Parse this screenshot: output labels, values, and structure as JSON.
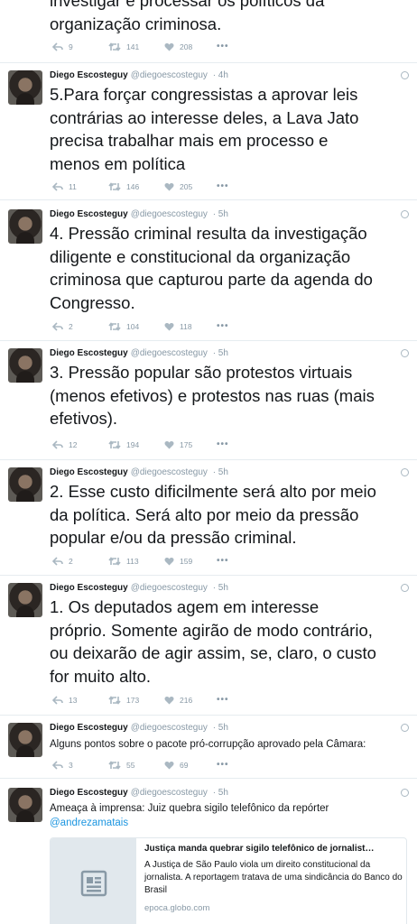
{
  "author": {
    "name": "Diego Escosteguy",
    "handle": "@diegoescosteguy"
  },
  "tweets": [
    {
      "time": "",
      "text": "investigar e processar os políticos da\norganização criminosa.",
      "replies": "9",
      "retweets": "141",
      "likes": "208"
    },
    {
      "time": "· 4h",
      "text": "5.Para forçar congressistas a aprovar leis\ncontrárias ao interesse deles, a Lava Jato\nprecisa trabalhar mais em processo e\nmenos em política",
      "replies": "11",
      "retweets": "146",
      "likes": "205"
    },
    {
      "time": "· 5h",
      "text": "4. Pressão criminal resulta da investigação\ndiligente e constitucional da organização\ncriminosa que capturou parte da agenda do\nCongresso.",
      "replies": "2",
      "retweets": "104",
      "likes": "118"
    },
    {
      "time": "· 5h",
      "text": "3. Pressão popular são protestos virtuais\n(menos efetivos) e protestos nas ruas (mais\nefetivos).",
      "replies": "12",
      "retweets": "194",
      "likes": "175"
    },
    {
      "time": "· 5h",
      "text": "2. Esse custo dificilmente será alto por meio\nda política. Será alto por meio da pressão\npopular e/ou da pressão criminal.",
      "replies": "2",
      "retweets": "113",
      "likes": "159"
    },
    {
      "time": "· 5h",
      "text": "1. Os deputados agem em interesse\npróprio. Somente agirão de modo contrário,\nou deixarão de agir assim, se, claro, o custo\nfor muito alto.",
      "replies": "13",
      "retweets": "173",
      "likes": "216"
    },
    {
      "time": "· 5h",
      "text": "Alguns pontos sobre o pacote pró-corrupção aprovado pela Câmara:",
      "replies": "3",
      "retweets": "55",
      "likes": "69"
    },
    {
      "time": "· 5h",
      "text": "Ameaça à imprensa: Juiz quebra sigilo telefônico da repórter",
      "mention": "@andrezamatais",
      "card": {
        "title": "Justiça manda quebrar sigilo telefônico de jornalist…",
        "description": "A Justiça de São Paulo viola um direito constitucional da jornalista. A reportagem tratava de uma sindicância do Banco do Brasil",
        "domain": "epoca.globo.com",
        "icon": "article-icon"
      }
    }
  ],
  "colors": {
    "name": "#14171a",
    "meta": "#8899a6",
    "link": "#1b95e0",
    "divider": "#e6ecf0"
  },
  "icons": {
    "reply": "reply-icon",
    "retweet": "retweet-icon",
    "like": "heart-icon",
    "more": "more-icon",
    "globe": "globe-icon"
  }
}
